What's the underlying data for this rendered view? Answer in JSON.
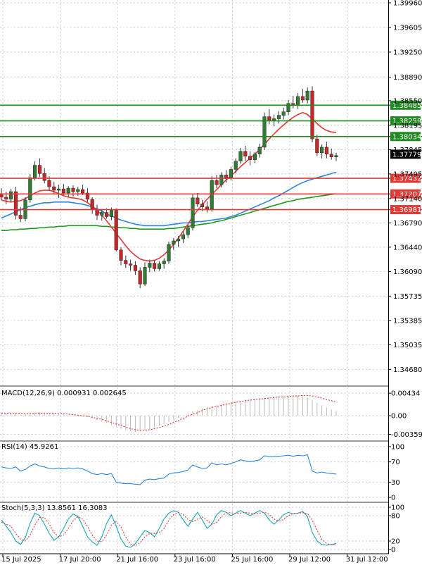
{
  "colors": {
    "bull": "#2e7d32",
    "bear": "#c62828",
    "green_level": "#1f8a1f",
    "red_level": "#e53935",
    "ma_fast": "#e53935",
    "ma_mid": "#2e86de",
    "ma_slow": "#229922",
    "price_tag": "#000000"
  },
  "chart_data": [
    {
      "type": "candlestick",
      "name": "price",
      "ylim": [
        1.3445,
        1.4
      ],
      "y_ticks": [
        "1.39960",
        "1.39605",
        "1.39250",
        "1.38890",
        "1.38550",
        "1.38195",
        "1.37845",
        "1.37495",
        "1.37140",
        "1.36790",
        "1.36440",
        "1.36090",
        "1.35735",
        "1.35385",
        "1.35035",
        "1.34680"
      ],
      "y_tick_values": [
        1.3996,
        1.39605,
        1.3925,
        1.3889,
        1.3855,
        1.38195,
        1.37845,
        1.37495,
        1.3714,
        1.3679,
        1.3644,
        1.3609,
        1.35735,
        1.35385,
        1.35035,
        1.3468
      ],
      "x_labels": [
        "15 Jul 2025",
        "17 Jul 20:00",
        "21 Jul 16:00",
        "23 Jul 16:00",
        "25 Jul 16:00",
        "29 Jul 12:00",
        "31 Jul 12:00"
      ],
      "x_label_index": [
        0,
        12,
        24,
        36,
        48,
        60,
        72
      ],
      "ohlc": [
        [
          1.3721,
          1.3729,
          1.3712,
          1.3716
        ],
        [
          1.3716,
          1.3724,
          1.3706,
          1.3713
        ],
        [
          1.3713,
          1.3728,
          1.3709,
          1.3724
        ],
        [
          1.3724,
          1.3731,
          1.3684,
          1.369
        ],
        [
          1.369,
          1.3702,
          1.368,
          1.3685
        ],
        [
          1.3685,
          1.3716,
          1.3681,
          1.3712
        ],
        [
          1.3712,
          1.3749,
          1.3708,
          1.3744
        ],
        [
          1.3744,
          1.3768,
          1.374,
          1.3762
        ],
        [
          1.3762,
          1.3772,
          1.3745,
          1.375
        ],
        [
          1.375,
          1.3758,
          1.3736,
          1.374
        ],
        [
          1.374,
          1.3746,
          1.3725,
          1.3731
        ],
        [
          1.3731,
          1.3738,
          1.372,
          1.3726
        ],
        [
          1.3726,
          1.3734,
          1.3715,
          1.3728
        ],
        [
          1.3728,
          1.3735,
          1.3719,
          1.3722
        ],
        [
          1.3722,
          1.3732,
          1.3716,
          1.3729
        ],
        [
          1.3729,
          1.3733,
          1.3717,
          1.3724
        ],
        [
          1.3724,
          1.3731,
          1.3718,
          1.3727
        ],
        [
          1.3727,
          1.3734,
          1.3719,
          1.3722
        ],
        [
          1.3722,
          1.3729,
          1.3709,
          1.3713
        ],
        [
          1.3713,
          1.3716,
          1.3692,
          1.3699
        ],
        [
          1.3699,
          1.3705,
          1.3683,
          1.369
        ],
        [
          1.369,
          1.3699,
          1.3682,
          1.3694
        ],
        [
          1.3694,
          1.37,
          1.3685,
          1.3688
        ],
        [
          1.3688,
          1.3701,
          1.3683,
          1.3697
        ],
        [
          1.3697,
          1.37,
          1.3638,
          1.364
        ],
        [
          1.364,
          1.3644,
          1.3618,
          1.3625
        ],
        [
          1.3625,
          1.3632,
          1.3614,
          1.362
        ],
        [
          1.362,
          1.3626,
          1.361,
          1.3618
        ],
        [
          1.3618,
          1.3624,
          1.3604,
          1.361
        ],
        [
          1.361,
          1.3615,
          1.3585,
          1.3591
        ],
        [
          1.3591,
          1.3622,
          1.3588,
          1.3615
        ],
        [
          1.3615,
          1.3626,
          1.3608,
          1.3621
        ],
        [
          1.3621,
          1.3625,
          1.3609,
          1.3613
        ],
        [
          1.3613,
          1.3624,
          1.361,
          1.362
        ],
        [
          1.362,
          1.3628,
          1.3613,
          1.3624
        ],
        [
          1.3624,
          1.3652,
          1.362,
          1.3648
        ],
        [
          1.3648,
          1.3657,
          1.364,
          1.3653
        ],
        [
          1.3653,
          1.366,
          1.3644,
          1.3656
        ],
        [
          1.3656,
          1.3667,
          1.365,
          1.3662
        ],
        [
          1.3662,
          1.3676,
          1.3657,
          1.3672
        ],
        [
          1.3672,
          1.372,
          1.3668,
          1.3715
        ],
        [
          1.3715,
          1.3722,
          1.3702,
          1.3706
        ],
        [
          1.3706,
          1.3712,
          1.3696,
          1.3702
        ],
        [
          1.3702,
          1.371,
          1.3694,
          1.3699
        ],
        [
          1.3699,
          1.3746,
          1.3695,
          1.374
        ],
        [
          1.374,
          1.3748,
          1.3729,
          1.3734
        ],
        [
          1.3734,
          1.3752,
          1.373,
          1.3748
        ],
        [
          1.3748,
          1.3755,
          1.3737,
          1.3744
        ],
        [
          1.3744,
          1.376,
          1.374,
          1.3756
        ],
        [
          1.3756,
          1.3772,
          1.3751,
          1.3768
        ],
        [
          1.3768,
          1.3787,
          1.3764,
          1.3782
        ],
        [
          1.3782,
          1.379,
          1.3768,
          1.3775
        ],
        [
          1.3775,
          1.3782,
          1.3762,
          1.377
        ],
        [
          1.377,
          1.3781,
          1.3765,
          1.3778
        ],
        [
          1.3778,
          1.3793,
          1.3773,
          1.3788
        ],
        [
          1.3788,
          1.3838,
          1.3784,
          1.3832
        ],
        [
          1.3832,
          1.3843,
          1.3821,
          1.3826
        ],
        [
          1.3826,
          1.3835,
          1.3818,
          1.3829
        ],
        [
          1.3829,
          1.384,
          1.3822,
          1.3834
        ],
        [
          1.3834,
          1.3845,
          1.3828,
          1.3839
        ],
        [
          1.3839,
          1.3856,
          1.3834,
          1.3851
        ],
        [
          1.3851,
          1.3862,
          1.3844,
          1.3848
        ],
        [
          1.3848,
          1.3866,
          1.3843,
          1.3861
        ],
        [
          1.3861,
          1.3872,
          1.3852,
          1.3856
        ],
        [
          1.3856,
          1.3874,
          1.3851,
          1.3869
        ],
        [
          1.3869,
          1.3876,
          1.3795,
          1.38
        ],
        [
          1.38,
          1.3806,
          1.3775,
          1.378
        ],
        [
          1.378,
          1.3792,
          1.3772,
          1.3788
        ],
        [
          1.3788,
          1.3796,
          1.3772,
          1.3778
        ],
        [
          1.3778,
          1.3786,
          1.377,
          1.3774
        ],
        [
          1.3774,
          1.378,
          1.3768,
          1.3776
        ]
      ],
      "ma_fast": [
        1.3712,
        1.371,
        1.3709,
        1.371,
        1.3711,
        1.3714,
        1.3718,
        1.3722,
        1.3725,
        1.3726,
        1.3726,
        1.3724,
        1.3721,
        1.3718,
        1.3716,
        1.3715,
        1.3714,
        1.3712,
        1.3708,
        1.3703,
        1.3697,
        1.369,
        1.3682,
        1.3673,
        1.3664,
        1.3655,
        1.3646,
        1.3638,
        1.3632,
        1.3627,
        1.3625,
        1.3624,
        1.3625,
        1.3628,
        1.3633,
        1.364,
        1.3648,
        1.3657,
        1.3667,
        1.3677,
        1.3688,
        1.3697,
        1.3705,
        1.3713,
        1.372,
        1.3727,
        1.3734,
        1.3741,
        1.3747,
        1.3753,
        1.376,
        1.3766,
        1.3772,
        1.3778,
        1.3785,
        1.3792,
        1.38,
        1.3807,
        1.3814,
        1.382,
        1.3826,
        1.3831,
        1.3835,
        1.3838,
        1.3835,
        1.3829,
        1.3822,
        1.3816,
        1.3812,
        1.381,
        1.3809
      ],
      "ma_mid": [
        1.3686,
        1.3689,
        1.3692,
        1.3695,
        1.3698,
        1.3701,
        1.3703,
        1.3705,
        1.3707,
        1.3708,
        1.3708,
        1.3709,
        1.3709,
        1.3709,
        1.3709,
        1.3708,
        1.3707,
        1.3706,
        1.3704,
        1.3702,
        1.3699,
        1.3696,
        1.3692,
        1.3689,
        1.3686,
        1.3683,
        1.3681,
        1.3679,
        1.3677,
        1.3676,
        1.3675,
        1.3675,
        1.3675,
        1.3675,
        1.3675,
        1.3676,
        1.3677,
        1.3678,
        1.3679,
        1.3679,
        1.368,
        1.3681,
        1.3681,
        1.3682,
        1.3683,
        1.3684,
        1.3685,
        1.3686,
        1.3688,
        1.369,
        1.3693,
        1.3696,
        1.3699,
        1.3702,
        1.3705,
        1.3708,
        1.3711,
        1.3715,
        1.3718,
        1.3722,
        1.3726,
        1.373,
        1.3734,
        1.3737,
        1.374,
        1.3742,
        1.3744,
        1.3746,
        1.3748,
        1.375,
        1.3752
      ],
      "ma_slow": [
        1.3668,
        1.3668,
        1.3669,
        1.3669,
        1.367,
        1.367,
        1.3671,
        1.3671,
        1.3672,
        1.3672,
        1.3673,
        1.3673,
        1.3674,
        1.3674,
        1.3675,
        1.3675,
        1.3675,
        1.3675,
        1.3675,
        1.3675,
        1.3675,
        1.3674,
        1.3674,
        1.3673,
        1.3673,
        1.3672,
        1.3672,
        1.3671,
        1.3671,
        1.367,
        1.367,
        1.367,
        1.367,
        1.367,
        1.367,
        1.3671,
        1.3671,
        1.3672,
        1.3673,
        1.3674,
        1.3675,
        1.3676,
        1.3677,
        1.3678,
        1.3679,
        1.3681,
        1.3682,
        1.3684,
        1.3686,
        1.3688,
        1.369,
        1.3692,
        1.3694,
        1.3696,
        1.3698,
        1.37,
        1.3702,
        1.3704,
        1.3706,
        1.3708,
        1.371,
        1.3711,
        1.3713,
        1.3714,
        1.3715,
        1.3716,
        1.3717,
        1.3718,
        1.3719,
        1.372,
        1.3721
      ],
      "levels": [
        {
          "value": 1.38485,
          "label": "1.38485",
          "kind": "green"
        },
        {
          "value": 1.38259,
          "label": "1.38259",
          "kind": "green"
        },
        {
          "value": 1.38034,
          "label": "1.38034",
          "kind": "green"
        },
        {
          "value": 1.37432,
          "label": "1.37432",
          "kind": "red"
        },
        {
          "value": 1.37207,
          "label": "1.37207",
          "kind": "red"
        },
        {
          "value": 1.36981,
          "label": "1.36981",
          "kind": "red"
        }
      ],
      "current_price": {
        "value": 1.37779,
        "label": "1.37779"
      }
    },
    {
      "type": "macd",
      "title": "MACD(12,26,9) 0.000931 0.002645",
      "ylim": [
        -0.0042,
        0.0049
      ],
      "y_ticks": [
        "0.00434",
        "0.00",
        "-0.003597"
      ],
      "y_tick_values": [
        0.00434,
        0.0,
        -0.003597
      ],
      "hist": [
        0.0006,
        0.0006,
        0.0005,
        0.0004,
        0.0003,
        0.0003,
        0.0004,
        0.0006,
        0.0007,
        0.0006,
        0.0005,
        0.0004,
        0.0003,
        0.0002,
        0.0001,
        0.0001,
        0.0,
        -0.0001,
        -0.0003,
        -0.0005,
        -0.0008,
        -0.0011,
        -0.0014,
        -0.0018,
        -0.0022,
        -0.0025,
        -0.0028,
        -0.003,
        -0.0031,
        -0.003,
        -0.0028,
        -0.0026,
        -0.0023,
        -0.002,
        -0.0016,
        -0.0012,
        -0.0008,
        -0.0004,
        0.0,
        0.0004,
        0.0008,
        0.0011,
        0.0014,
        0.0017,
        0.0019,
        0.0021,
        0.0023,
        0.0025,
        0.0026,
        0.0028,
        0.0029,
        0.0031,
        0.0032,
        0.0033,
        0.0034,
        0.0035,
        0.0036,
        0.0037,
        0.0037,
        0.0038,
        0.0038,
        0.0039,
        0.0039,
        0.0039,
        0.0035,
        0.003,
        0.0025,
        0.002,
        0.0016,
        0.0012,
        0.0009
      ],
      "signal": [
        0.0005,
        0.0005,
        0.0005,
        0.0005,
        0.0005,
        0.0004,
        0.0004,
        0.0005,
        0.0005,
        0.0005,
        0.0005,
        0.0005,
        0.0004,
        0.0004,
        0.0003,
        0.0002,
        0.0001,
        0.0,
        -0.0001,
        -0.0003,
        -0.0005,
        -0.0007,
        -0.001,
        -0.0013,
        -0.0016,
        -0.0019,
        -0.0022,
        -0.0025,
        -0.0027,
        -0.0028,
        -0.0028,
        -0.0027,
        -0.0025,
        -0.0023,
        -0.002,
        -0.0017,
        -0.0013,
        -0.0009,
        -0.0005,
        -0.0001,
        0.0003,
        0.0006,
        0.001,
        0.0013,
        0.0016,
        0.0018,
        0.002,
        0.0022,
        0.0024,
        0.0026,
        0.0027,
        0.0029,
        0.003,
        0.0031,
        0.0032,
        0.0033,
        0.0034,
        0.0035,
        0.0036,
        0.0036,
        0.0037,
        0.0038,
        0.0038,
        0.0039,
        0.0039,
        0.0038,
        0.0036,
        0.0034,
        0.0031,
        0.0029,
        0.0026
      ]
    },
    {
      "type": "line",
      "title": "RSI(14) 45.9261",
      "ylim": [
        0,
        100
      ],
      "y_ticks": [
        "100",
        "70",
        "30",
        "0"
      ],
      "y_tick_values": [
        100,
        70,
        30,
        0
      ],
      "values": [
        60,
        58,
        57,
        60,
        52,
        55,
        62,
        66,
        62,
        60,
        57,
        56,
        58,
        56,
        58,
        57,
        58,
        56,
        52,
        47,
        45,
        47,
        45,
        47,
        30,
        28,
        27,
        27,
        26,
        25,
        34,
        36,
        35,
        37,
        38,
        46,
        48,
        49,
        51,
        54,
        64,
        60,
        57,
        58,
        68,
        64,
        66,
        64,
        67,
        70,
        74,
        72,
        70,
        72,
        74,
        82,
        80,
        80,
        81,
        82,
        83,
        81,
        83,
        82,
        84,
        52,
        48,
        50,
        48,
        47,
        46
      ]
    },
    {
      "type": "line",
      "title": "Stoch(5,3,3) 13.8561 16.3083",
      "ylim": [
        0,
        100
      ],
      "y_ticks": [
        "100",
        "80",
        "20",
        "0"
      ],
      "y_tick_values": [
        100,
        80,
        20,
        0
      ],
      "main": [
        70,
        55,
        40,
        20,
        12,
        28,
        62,
        86,
        80,
        60,
        38,
        22,
        30,
        50,
        72,
        84,
        78,
        55,
        30,
        18,
        10,
        30,
        62,
        82,
        55,
        25,
        8,
        5,
        14,
        30,
        45,
        40,
        30,
        50,
        72,
        86,
        92,
        88,
        70,
        55,
        72,
        88,
        70,
        50,
        60,
        82,
        92,
        88,
        80,
        86,
        92,
        86,
        80,
        86,
        92,
        86,
        70,
        60,
        70,
        82,
        88,
        84,
        86,
        90,
        78,
        40,
        20,
        12,
        10,
        12,
        14
      ],
      "signal": [
        65,
        60,
        55,
        38,
        24,
        20,
        34,
        58,
        76,
        75,
        60,
        40,
        30,
        34,
        50,
        68,
        78,
        72,
        55,
        34,
        20,
        19,
        34,
        58,
        66,
        54,
        29,
        13,
        9,
        16,
        30,
        38,
        38,
        40,
        50,
        69,
        83,
        88,
        83,
        71,
        66,
        72,
        77,
        69,
        60,
        64,
        78,
        87,
        87,
        85,
        86,
        88,
        86,
        84,
        86,
        88,
        83,
        72,
        67,
        71,
        80,
        85,
        86,
        87,
        85,
        69,
        46,
        24,
        14,
        11,
        12
      ]
    }
  ]
}
